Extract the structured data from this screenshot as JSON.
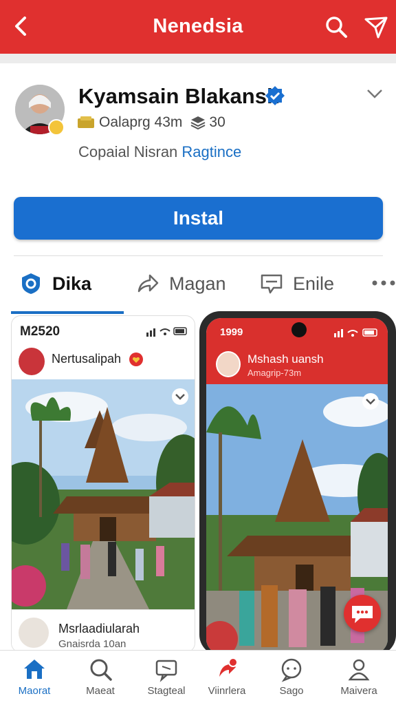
{
  "header": {
    "title": "Nenedsia"
  },
  "profile": {
    "name": "Kyamsain Blakansh",
    "stat1": "Oalaprg 43m",
    "stat2": "30",
    "desc_prefix": "Copaial Nisran",
    "desc_link": "Ragtince"
  },
  "install_label": "Instal",
  "tabs": [
    {
      "label": "Dika",
      "icon": "shield-icon"
    },
    {
      "label": "Magan",
      "icon": "share-arrow-icon"
    },
    {
      "label": "Enile",
      "icon": "comment-icon"
    }
  ],
  "screenshot_left": {
    "status_time": "M2520",
    "post_name": "Nertusalipah",
    "footer_name": "Msrlaadiularah",
    "footer_sub": "Gnaisrda 10an"
  },
  "screenshot_right": {
    "status_time": "1999",
    "post_name": "Mshash uansh",
    "post_sub": "Amagrip-73m"
  },
  "bottom_nav": [
    {
      "label": "Maorat",
      "icon": "home-icon"
    },
    {
      "label": "Maeat",
      "icon": "search-icon"
    },
    {
      "label": "Stagteal",
      "icon": "chat-box-icon"
    },
    {
      "label": "Viinrlera",
      "icon": "notification-icon"
    },
    {
      "label": "Sago",
      "icon": "message-icon"
    },
    {
      "label": "Maivera",
      "icon": "profile-icon"
    }
  ],
  "colors": {
    "brand_red": "#e0302f",
    "accent_blue": "#1a6fd0"
  }
}
